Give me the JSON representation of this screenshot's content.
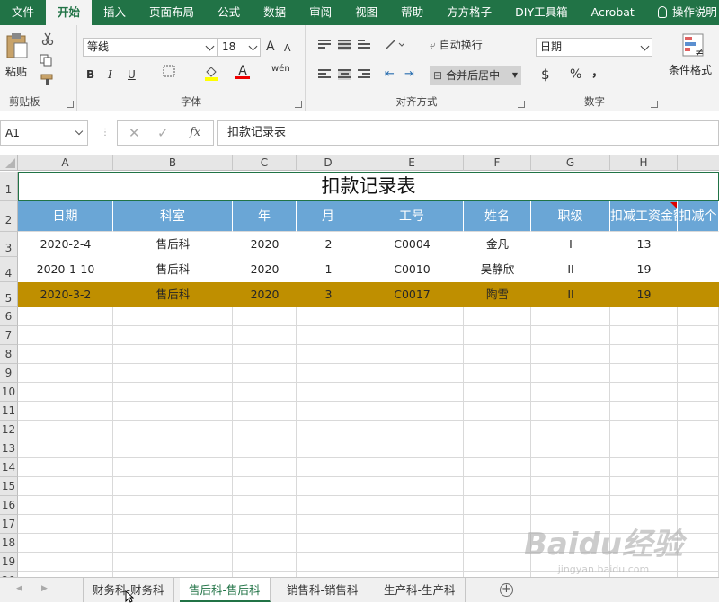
{
  "menu_tabs": [
    "文件",
    "开始",
    "插入",
    "页面布局",
    "公式",
    "数据",
    "审阅",
    "视图",
    "帮助",
    "方方格子",
    "DIY工具箱",
    "Acrobat",
    "操作说明"
  ],
  "ribbon": {
    "clipboard": {
      "paste": "粘贴",
      "label": "剪贴板"
    },
    "font": {
      "name": "等线",
      "size": "18",
      "bold": "B",
      "italic": "I",
      "underline": "U",
      "grow": "A",
      "shrink": "A",
      "color_letter": "A",
      "wen": "wén",
      "label": "字体"
    },
    "alignment": {
      "wrap": "自动换行",
      "merge": "合并后居中",
      "label": "对齐方式"
    },
    "number": {
      "format": "日期",
      "currency": "$",
      "percent": "%",
      "comma": "，",
      "label": "数字"
    },
    "styles": {
      "cond": "条件格式"
    }
  },
  "formula_bar": {
    "cell_ref": "A1",
    "content": "扣款记录表",
    "fx": "fx"
  },
  "columns": [
    "A",
    "B",
    "C",
    "D",
    "E",
    "F",
    "G",
    "H"
  ],
  "row_numbers": [
    "1",
    "2",
    "3",
    "4",
    "5",
    "6",
    "7",
    "8",
    "9",
    "10",
    "11",
    "12",
    "13",
    "14",
    "15",
    "16",
    "17",
    "18",
    "19",
    "20"
  ],
  "sheet": {
    "title": "扣款记录表",
    "headers": [
      "日期",
      "科室",
      "年",
      "月",
      "工号",
      "姓名",
      "职级",
      "扣减工资金额",
      "扣减个"
    ],
    "rows": [
      [
        "2020-2-4",
        "售后科",
        "2020",
        "2",
        "C0004",
        "金凡",
        "I",
        "13"
      ],
      [
        "2020-1-10",
        "售后科",
        "2020",
        "1",
        "C0010",
        "吴静欣",
        "II",
        "19"
      ],
      [
        "2020-3-2",
        "售后科",
        "2020",
        "3",
        "C0017",
        "陶雪",
        "II",
        "19"
      ]
    ],
    "highlight_color": "#bf8f00",
    "header_color": "#6aa6d6"
  },
  "sheet_tabs": [
    "财务科-财务科",
    "售后科-售后科",
    "销售科-销售科",
    "生产科-生产科"
  ],
  "active_sheet": "售后科-售后科",
  "watermark": {
    "main": "Baidu经验",
    "sub": "jingyan.baidu.com"
  }
}
